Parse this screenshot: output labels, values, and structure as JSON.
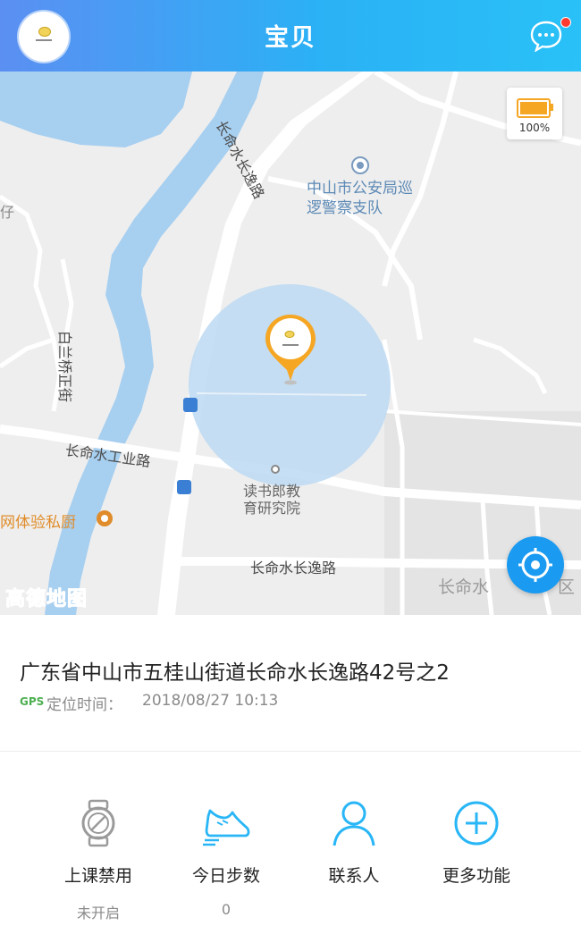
{
  "header": {
    "title": "宝贝",
    "avatar_icon": "watch-logo",
    "message_icon": "chat-bubble-icon"
  },
  "map": {
    "battery_level": 1.0,
    "battery_text": "100%",
    "labels": {
      "police": "中山市公安局巡逻警察支队",
      "road_changming_left": "长命水长逸路",
      "road_changming_bottom": "长命水长逸路",
      "road_changming_right": "长命水",
      "district_fragment": "区",
      "baiqiao": "白兰桥正街",
      "industrial": "长命水工业路",
      "school": "读书郎教育研究院",
      "kitchen": "网体验私厨",
      "fragment_left": "仔"
    },
    "attribution": "高德地图",
    "colors": {
      "water": "#a7cff0",
      "accuracy_circle": "#bcd9f2",
      "pin": "#f5a623",
      "locate_button": "#1a9af0"
    }
  },
  "location": {
    "address": "广东省中山市五桂山街道长命水长逸路42号之2",
    "gps_tag": "GPS",
    "time_label": "定位时间：",
    "time_value": "2018/08/27 10:13"
  },
  "functions": [
    {
      "label": "上课禁用",
      "sub": "未开启",
      "icon": "watch-icon"
    },
    {
      "label": "今日步数",
      "sub": "0",
      "icon": "shoe-icon"
    },
    {
      "label": "联系人",
      "sub": "",
      "icon": "person-icon"
    },
    {
      "label": "更多功能",
      "sub": "",
      "icon": "plus-circle-icon"
    }
  ],
  "colors": {
    "accent": "#29b6f6",
    "header_start": "#5b8ff2",
    "header_end": "#29c1f7"
  }
}
